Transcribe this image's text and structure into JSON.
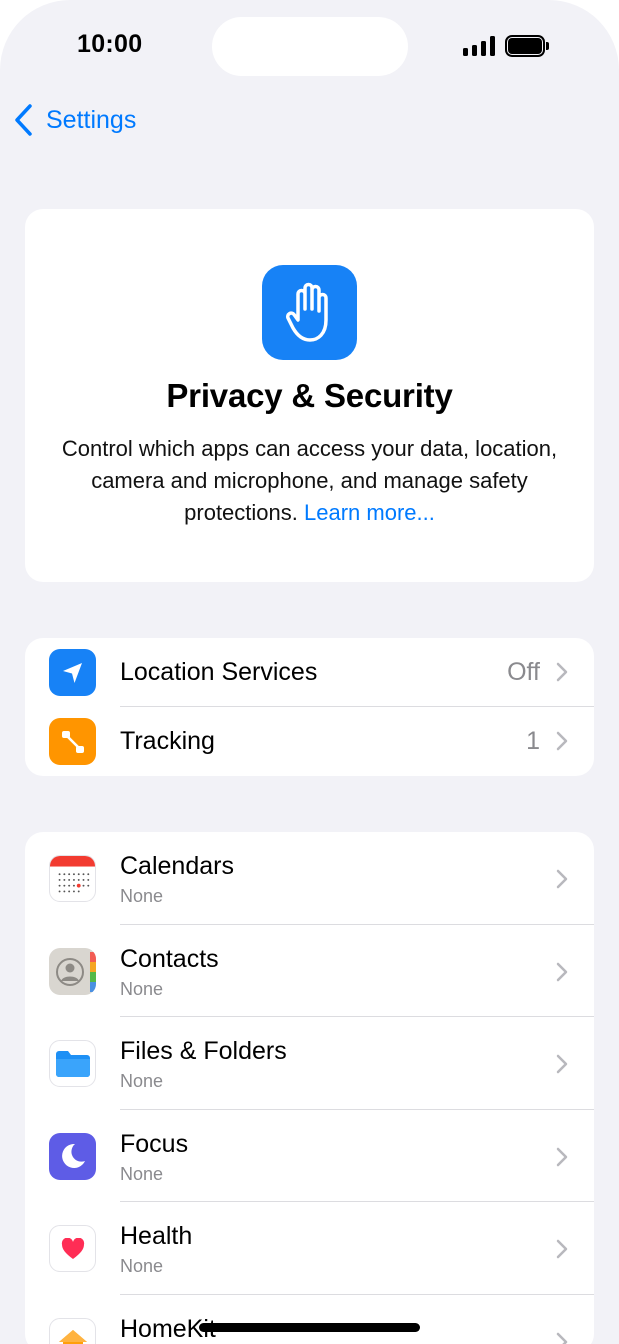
{
  "status_bar": {
    "time": "10:00"
  },
  "nav": {
    "back_label": "Settings"
  },
  "header": {
    "title": "Privacy & Security",
    "description": "Control which apps can access your data, location, camera and microphone, and manage safety protections.",
    "learn_more": "Learn more..."
  },
  "group1": [
    {
      "label": "Location Services",
      "value": "Off",
      "icon": "location-arrow-icon",
      "color": "#1782f6"
    },
    {
      "label": "Tracking",
      "value": "1",
      "icon": "tracking-icon",
      "color": "#ff9500"
    }
  ],
  "group2": [
    {
      "label": "Calendars",
      "sub": "None",
      "icon": "calendar-icon"
    },
    {
      "label": "Contacts",
      "sub": "None",
      "icon": "contacts-icon"
    },
    {
      "label": "Files & Folders",
      "sub": "None",
      "icon": "folder-icon"
    },
    {
      "label": "Focus",
      "sub": "None",
      "icon": "moon-icon",
      "color": "#5e5ce6"
    },
    {
      "label": "Health",
      "sub": "None",
      "icon": "heart-icon"
    },
    {
      "label": "HomeKit",
      "sub": "",
      "icon": "home-icon"
    }
  ],
  "colors": {
    "accent": "#007aff",
    "background": "#f2f2f7",
    "secondary_text": "#8a8a8e"
  }
}
